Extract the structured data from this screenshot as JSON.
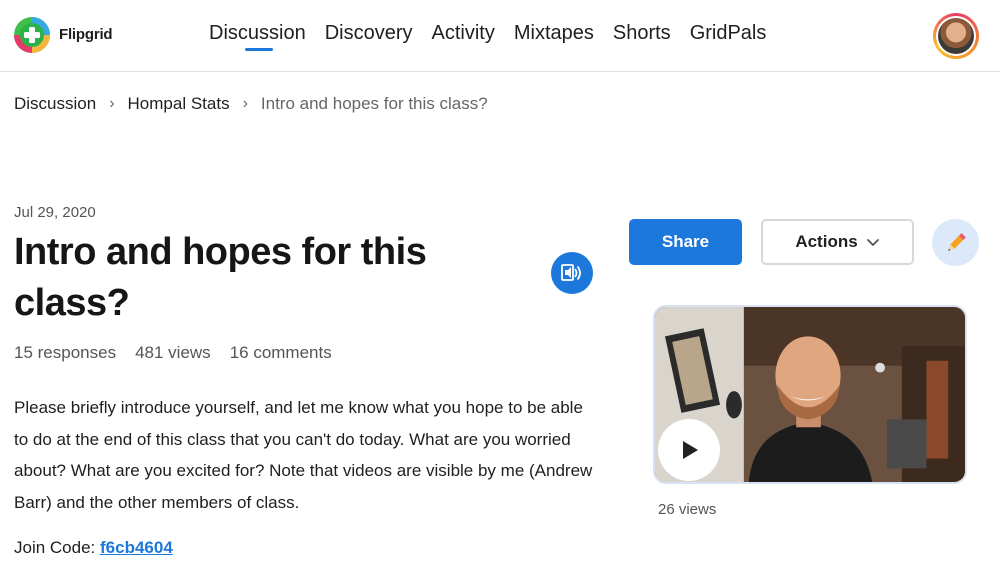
{
  "app": {
    "brand": "Flipgrid"
  },
  "nav": {
    "items": [
      {
        "label": "Discussion",
        "active": true
      },
      {
        "label": "Discovery",
        "active": false
      },
      {
        "label": "Activity",
        "active": false
      },
      {
        "label": "Mixtapes",
        "active": false
      },
      {
        "label": "Shorts",
        "active": false
      },
      {
        "label": "GridPals",
        "active": false
      }
    ]
  },
  "breadcrumb": {
    "items": [
      "Discussion",
      "Hompal Stats",
      "Intro and hopes for this class?"
    ]
  },
  "topic": {
    "date": "Jul 29, 2020",
    "title": "Intro and hopes for this class?",
    "stats": {
      "responses": "15 responses",
      "views": "481 views",
      "comments": "16 comments"
    },
    "description": "Please briefly introduce yourself, and let me know what you hope to be able to do at the end of this class that you can't do today.  What are you worried about? What are you excited for? Note that videos are visible by me (Andrew Barr) and the other members of class.",
    "join_code_label": "Join Code:",
    "join_code": "f6cb4604"
  },
  "actions": {
    "share_label": "Share",
    "actions_label": "Actions"
  },
  "video": {
    "views": "26 views"
  },
  "icons": {
    "logo": "flipgrid-logo-icon",
    "audio": "immersive-reader-icon",
    "edit": "pencil-icon",
    "play": "play-icon",
    "caret": "chevron-down-icon"
  },
  "colors": {
    "accent": "#1d78db",
    "edit_bg": "#dbe9fb"
  }
}
